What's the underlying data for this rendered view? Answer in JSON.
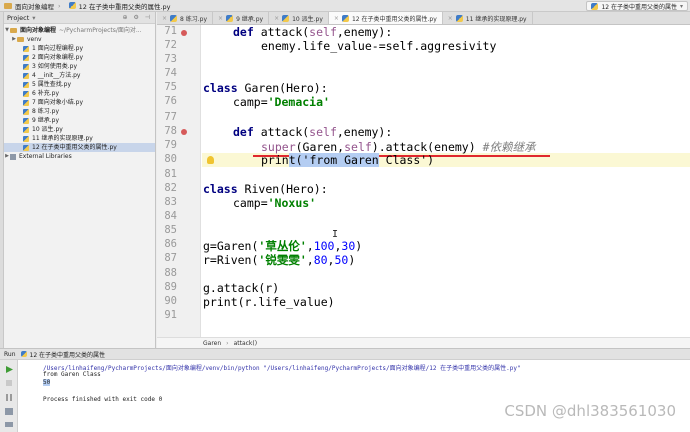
{
  "navbar": {
    "crumb1": "面向对象编程",
    "crumb2": "12 在子类中重用父类的属性.py",
    "right_label": "12 在子类中重用父类的属性"
  },
  "project": {
    "header": "Project",
    "root": "面向对象编程",
    "root_path": "~/PycharmProjects/面向对...",
    "folder": "venv",
    "files": [
      "1 面向过程编程.py",
      "2 面向对象编程.py",
      "3 如何使用类.py",
      "4 __init__方法.py",
      "5 属性查找.py",
      "6 补充.py",
      "7 面向对象小结.py",
      "8 练习.py",
      "9 继承.py",
      "10 派生.py",
      "11 继承的实现原理.py",
      "12 在子类中重用父类的属性.py"
    ],
    "external": "External Libraries"
  },
  "tabs": [
    "8 练习.py",
    "9 继承.py",
    "10 派生.py",
    "12 在子类中重用父类的属性.py",
    "11 继承的实现原理.py"
  ],
  "editor": {
    "lines": {
      "l71": "71",
      "l72": "72",
      "l73": "73",
      "l74": "74",
      "l75": "75",
      "l76": "76",
      "l77": "77",
      "l78": "78",
      "l79": "79",
      "l80": "80",
      "l81": "81",
      "l82": "82",
      "l83": "83",
      "l84": "84",
      "l85": "85",
      "l86": "86",
      "l87": "87",
      "l88": "88",
      "l89": "89",
      "l90": "90",
      "l91": "91"
    },
    "code": {
      "c71_def": "def",
      "c71_name": " attack(",
      "c71_self": "self",
      "c71_rest": ",enemy):",
      "c72": "enemy.life_value-=self.aggresivity",
      "c75_kw": "class",
      "c75_rest": " Garen(Hero):",
      "c76_a": "camp=",
      "c76_s": "'Demacia'",
      "c78_def": "def",
      "c78_name": " attack(",
      "c78_self": "self",
      "c78_rest": ",enemy):",
      "c79_super": "super",
      "c79_a": "(Garen,",
      "c79_self": "self",
      "c79_b": ").attack(enemy) ",
      "c79_cmt": "#依赖继承",
      "c80_a": "prin",
      "c80_sel": "t('from Garen",
      "c80_b": " Class')",
      "c82_kw": "class",
      "c82_rest": " Riven(Hero):",
      "c83_a": "camp=",
      "c83_s": "'Noxus'",
      "c86_a": "g=Garen(",
      "c86_s": "'草丛伦'",
      "c86_b": ",",
      "c86_n1": "100",
      "c86_c": ",",
      "c86_n2": "30",
      "c86_d": ")",
      "c87_a": "r=Riven(",
      "c87_s": "'锐雯雯'",
      "c87_b": ",",
      "c87_n1": "80",
      "c87_c": ",",
      "c87_n2": "50",
      "c87_d": ")",
      "c89": "g.attack(r)",
      "c90": "print(r.life_value)"
    },
    "cursor_glyph": "I",
    "breadcrumb": [
      "Garen",
      "attack()"
    ]
  },
  "run": {
    "label": "Run",
    "config": "12 在子类中重用父类的属性",
    "command": "/Users/linhaifeng/PycharmProjects/面向对象编程/venv/bin/python \"/Users/linhaifeng/PycharmProjects/面向对象编程/12 在子类中重用父类的属性.py\"",
    "out1": "from Garen Class",
    "out2": "50",
    "exit": "Process finished with exit code 0"
  },
  "watermark": "CSDN @dhl383561030"
}
